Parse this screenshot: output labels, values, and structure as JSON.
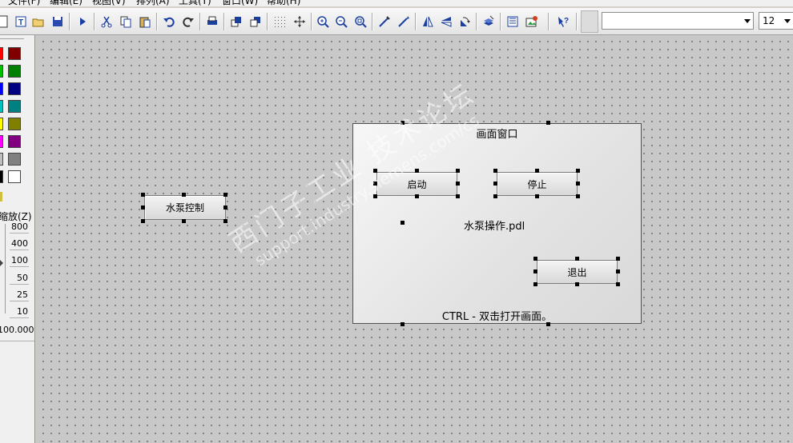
{
  "menu": [
    "文件(F)",
    "编辑(E)",
    "视图(V)",
    "排列(A)",
    "工具(T)",
    "窗口(W)",
    "帮助(H)"
  ],
  "toolbar": {
    "buttons": [
      "new-icon",
      "text-icon",
      "open-icon",
      "save-icon",
      "run-icon",
      "cut-icon",
      "copy-icon",
      "paste-icon",
      "undo-icon",
      "redo-icon",
      "print-icon",
      "bring-front-icon",
      "send-back-icon",
      "grid-icon",
      "snap-icon",
      "zoom-in-icon",
      "zoom-out-icon",
      "zoom-fit-icon",
      "property-icon",
      "dynamic-icon",
      "flip-h-icon",
      "flip-v-icon",
      "rotate-icon",
      "layer-icon",
      "library-icon",
      "object-icon",
      "help-icon"
    ],
    "style_value": "",
    "font_size": "12"
  },
  "palette": {
    "colors": [
      "#ff0000",
      "#800000",
      "#00c000",
      "#008000",
      "#0000ff",
      "#000080",
      "#00c0c0",
      "#008080",
      "#ffff00",
      "#808000",
      "#ff00ff",
      "#800080",
      "#c0c0c0",
      "#808080",
      "#000000",
      "#ffffff"
    ]
  },
  "zoom": {
    "title": "缩放(Z)",
    "levels": [
      "800",
      "400",
      "100",
      "50",
      "25",
      "10"
    ],
    "current": "100.000 %"
  },
  "canvas": {
    "pump_button": "水泵控制",
    "picture_window": {
      "title": "画面窗口",
      "start_button": "启动",
      "stop_button": "停止",
      "pdl_name": "水泵操作.pdl",
      "exit_button": "退出",
      "hint": "CTRL - 双击打开画面。"
    },
    "watermark_line1": "西门子工业  技术论坛",
    "watermark_line2": "support.industry.siemens.com/cs"
  }
}
